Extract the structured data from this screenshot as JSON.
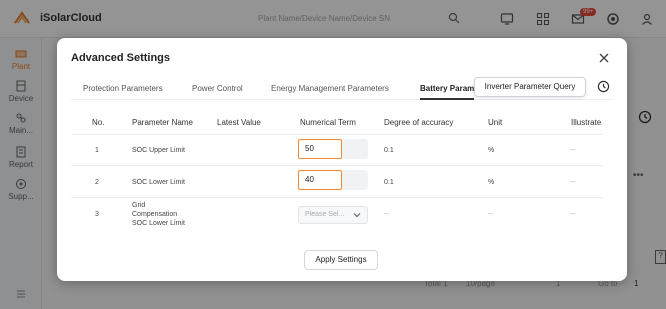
{
  "app": {
    "brand": "iSolarCloud",
    "search_placeholder": "Plant Name/Device Name/Device SN",
    "message_badge": "99+"
  },
  "sidebar": {
    "items": [
      {
        "label": "Plant",
        "icon": "plant-icon",
        "active": true
      },
      {
        "label": "Device",
        "icon": "device-icon"
      },
      {
        "label": "Main...",
        "icon": "maintenance-icon"
      },
      {
        "label": "Report",
        "icon": "report-icon"
      },
      {
        "label": "Supp...",
        "icon": "support-icon"
      }
    ]
  },
  "background": {
    "pager_total": "Total 1",
    "pager_size": "10/page",
    "pager_page": "1",
    "pager_goto": "Go to",
    "pager_goto_value": "1"
  },
  "modal": {
    "title": "Advanced Settings",
    "tabs": [
      {
        "label": "Protection Parameters"
      },
      {
        "label": "Power Control"
      },
      {
        "label": "Energy Management Parameters"
      },
      {
        "label": "Battery Param",
        "active": true
      }
    ],
    "inverter_query_label": "Inverter Parameter Query",
    "columns": [
      "No.",
      "Parameter Name",
      "Latest Value",
      "Numerical Term",
      "Degree of accuracy",
      "Unit",
      "Illustrate"
    ],
    "rows": [
      {
        "no": "1",
        "name": "SOC Upper Limit",
        "latest": "",
        "value": "50",
        "accuracy": "0.1",
        "unit": "%",
        "illustrate": "--"
      },
      {
        "no": "2",
        "name": "SOC Lower Limit",
        "latest": "",
        "value": "40",
        "accuracy": "0.1",
        "unit": "%",
        "illustrate": "--"
      },
      {
        "no": "3",
        "name_lines": [
          "Grid",
          "Compensation",
          "SOC Lower Limit"
        ],
        "latest": "",
        "select_placeholder": "Please Sel...",
        "accuracy": "--",
        "unit": "--",
        "illustrate": "--"
      }
    ],
    "apply_label": "Apply Settings"
  },
  "colors": {
    "accent": "#f08a36",
    "brand_orange": "#e87e2d",
    "badge_red": "#e84a3b"
  }
}
